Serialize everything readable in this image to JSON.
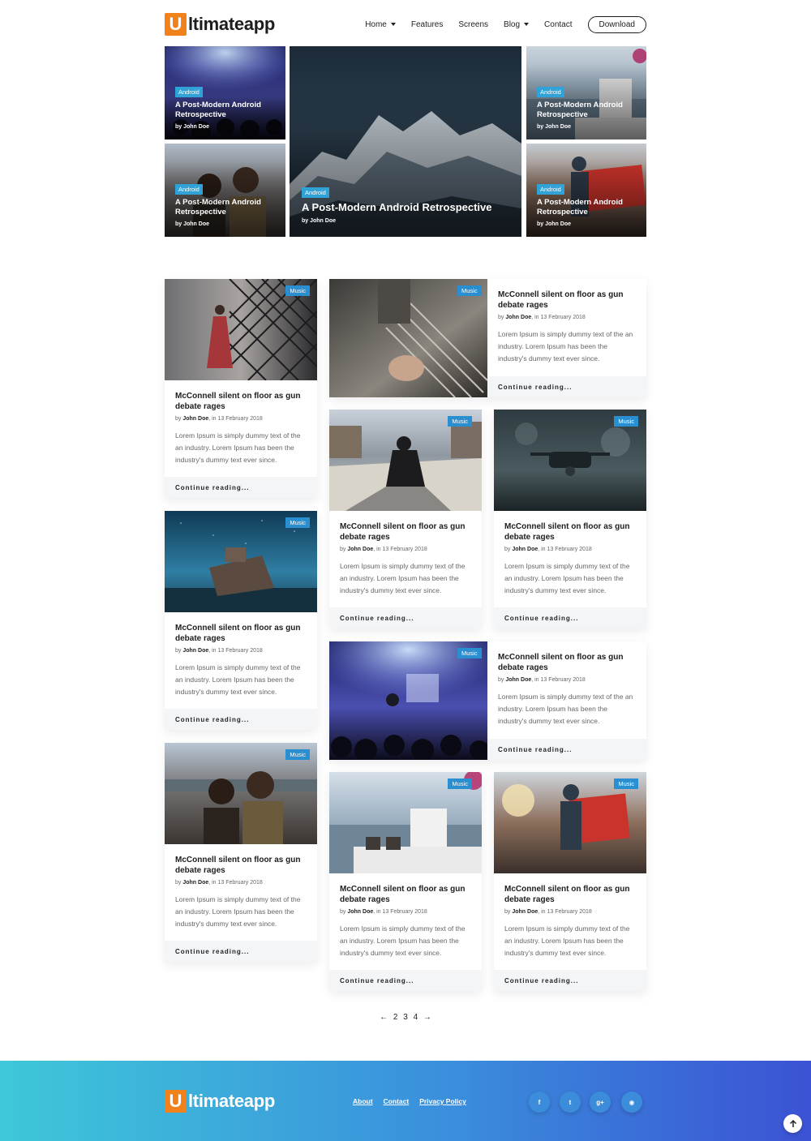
{
  "brand": {
    "mark": "U",
    "name": "ltimateapp",
    "accent": "#f0811b"
  },
  "nav": {
    "items": [
      {
        "label": "Home",
        "dropdown": true
      },
      {
        "label": "Features",
        "dropdown": false
      },
      {
        "label": "Screens",
        "dropdown": false
      },
      {
        "label": "Blog",
        "dropdown": true
      },
      {
        "label": "Contact",
        "dropdown": false
      }
    ],
    "download": "Download"
  },
  "hero": {
    "tiles": [
      {
        "badge": "Android",
        "title": "A Post-Modern Android Retrospective",
        "by": "by John Doe",
        "image": "concert"
      },
      {
        "badge": "Android",
        "title": "A Post-Modern Android Retrospective",
        "by": "by John Doe",
        "image": "mountain"
      },
      {
        "badge": "Android",
        "title": "A Post-Modern Android Retrospective",
        "by": "by John Doe",
        "image": "coast"
      },
      {
        "badge": "Android",
        "title": "A Post-Modern Android Retrospective",
        "by": "by John Doe",
        "image": "portraits"
      },
      {
        "badge": "Android",
        "title": "A Post-Modern Android Retrospective",
        "by": "by John Doe",
        "image": "keep-exploring"
      }
    ]
  },
  "posts": [
    {
      "badge": "Music",
      "title": "McConnell silent on floor as gun debate rages",
      "author": "John Doe",
      "date": ", in 13 February 2018",
      "excerpt": "Lorem Ipsum is simply dummy text of the an industry. Lorem Ipsum has been the industry's dummy text ever since.",
      "cta": "Continue reading...",
      "image": "fence-dancer"
    },
    {
      "badge": "Music",
      "title": "McConnell silent on floor as gun debate rages",
      "author": "John Doe",
      "date": ", in 13 February 2018",
      "excerpt": "Lorem Ipsum is simply dummy text of the an industry. Lorem Ipsum has been the industry's dummy text ever since.",
      "cta": "Continue reading...",
      "image": "records"
    },
    {
      "badge": "Music",
      "title": "McConnell silent on floor as gun debate rages",
      "author": "John Doe",
      "date": ", in 13 February 2018",
      "excerpt": "Lorem Ipsum is simply dummy text of the an industry. Lorem Ipsum has been the industry's dummy text ever since.",
      "cta": "Continue reading...",
      "image": "photographer"
    },
    {
      "badge": "Music",
      "title": "McConnell silent on floor as gun debate rages",
      "author": "John Doe",
      "date": ", in 13 February 2018",
      "excerpt": "Lorem Ipsum is simply dummy text of the an industry. Lorem Ipsum has been the industry's dummy text ever since.",
      "cta": "Continue reading...",
      "image": "drone"
    },
    {
      "badge": "Music",
      "title": "McConnell silent on floor as gun debate rages",
      "author": "John Doe",
      "date": ", in 13 February 2018",
      "excerpt": "Lorem Ipsum is simply dummy text of the an industry. Lorem Ipsum has been the industry's dummy text ever since.",
      "cta": "Continue reading...",
      "image": "shipwreck"
    },
    {
      "badge": "Music",
      "title": "McConnell silent on floor as gun debate rages",
      "author": "John Doe",
      "date": ", in 13 February 2018",
      "excerpt": "Lorem Ipsum is simply dummy text of the an industry. Lorem Ipsum has been the industry's dummy text ever since.",
      "cta": "Continue reading...",
      "image": "concert"
    },
    {
      "badge": "Music",
      "title": "McConnell silent on floor as gun debate rages",
      "author": "John Doe",
      "date": ", in 13 February 2018",
      "excerpt": "Lorem Ipsum is simply dummy text of the an industry. Lorem Ipsum has been the industry's dummy text ever since.",
      "cta": "Continue reading...",
      "image": "portraits"
    },
    {
      "badge": "Music",
      "title": "McConnell silent on floor as gun debate rages",
      "author": "John Doe",
      "date": ", in 13 February 2018",
      "excerpt": "Lorem Ipsum is simply dummy text of the an industry. Lorem Ipsum has been the industry's dummy text ever since.",
      "cta": "Continue reading...",
      "image": "coast"
    },
    {
      "badge": "Music",
      "title": "McConnell silent on floor as gun debate rages",
      "author": "John Doe",
      "date": ", in 13 February 2018",
      "excerpt": "Lorem Ipsum is simply dummy text of the an industry. Lorem Ipsum has been the industry's dummy text ever since.",
      "cta": "Continue reading...",
      "image": "keep-exploring"
    }
  ],
  "pagination": {
    "prev": "←",
    "pages": [
      "2",
      "3",
      "4"
    ],
    "next": "→"
  },
  "footer": {
    "links": [
      "About",
      "Contact",
      "Privacy Policy"
    ],
    "social": [
      {
        "icon": "facebook-icon",
        "glyph": "f"
      },
      {
        "icon": "twitter-icon",
        "glyph": "t"
      },
      {
        "icon": "google-plus-icon",
        "glyph": "g+"
      },
      {
        "icon": "rss-icon",
        "glyph": "◉"
      }
    ],
    "to_top_icon": "arrow-up-icon"
  },
  "colors": {
    "badge_android": "#2fa3d8",
    "badge_music": "#2a8fd0",
    "footer_start": "#3ec7d9",
    "footer_end": "#3b52d4"
  }
}
